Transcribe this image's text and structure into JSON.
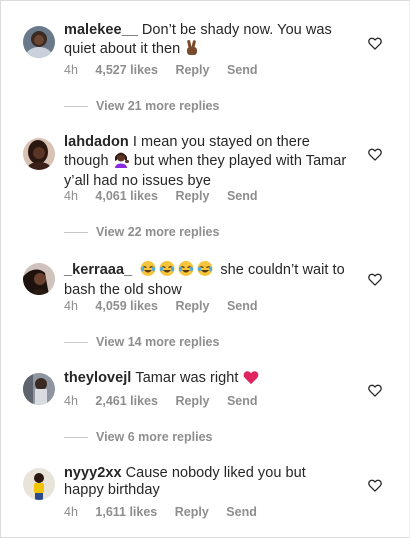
{
  "comments": [
    {
      "username": "malekee__",
      "text": "Don’t be shady now. You was quiet about it then",
      "emoji": "victory-hand-emoji",
      "time": "4h",
      "likes": "4,527 likes",
      "reply": "Reply",
      "send": "Send",
      "view_replies": "View 21 more replies"
    },
    {
      "username": "lahdadon",
      "text_line1": "I mean you stayed on there though",
      "emoji": "woman-tipping-hand-emoji",
      "text_line2": "but when they played with Tamar y’all had no issues bye",
      "time": "4h",
      "likes": "4,061 likes",
      "reply": "Reply",
      "send": "Send",
      "view_replies": "View 22 more replies"
    },
    {
      "username": "_kerraaa_",
      "emoji": "crying-laughing-emoji",
      "text": "she couldn’t wait to bash the old show",
      "time": "4h",
      "likes": "4,059 likes",
      "reply": "Reply",
      "send": "Send",
      "view_replies": "View 14 more replies"
    },
    {
      "username": "theylovejl",
      "text": "Tamar was right",
      "emoji": "red-heart-emoji",
      "time": "4h",
      "likes": "2,461 likes",
      "reply": "Reply",
      "send": "Send",
      "view_replies": "View 6 more replies"
    },
    {
      "username": "nyyy2xx",
      "text": "Cause nobody liked you but happy birthday",
      "time": "4h",
      "likes": "1,611 likes",
      "reply": "Reply",
      "send": "Send"
    }
  ],
  "colors": {
    "text": "#262626",
    "meta": "#8e8e8e",
    "heart_emoji": "#e0245e"
  },
  "icons": {
    "like": "heart-outline-icon"
  }
}
